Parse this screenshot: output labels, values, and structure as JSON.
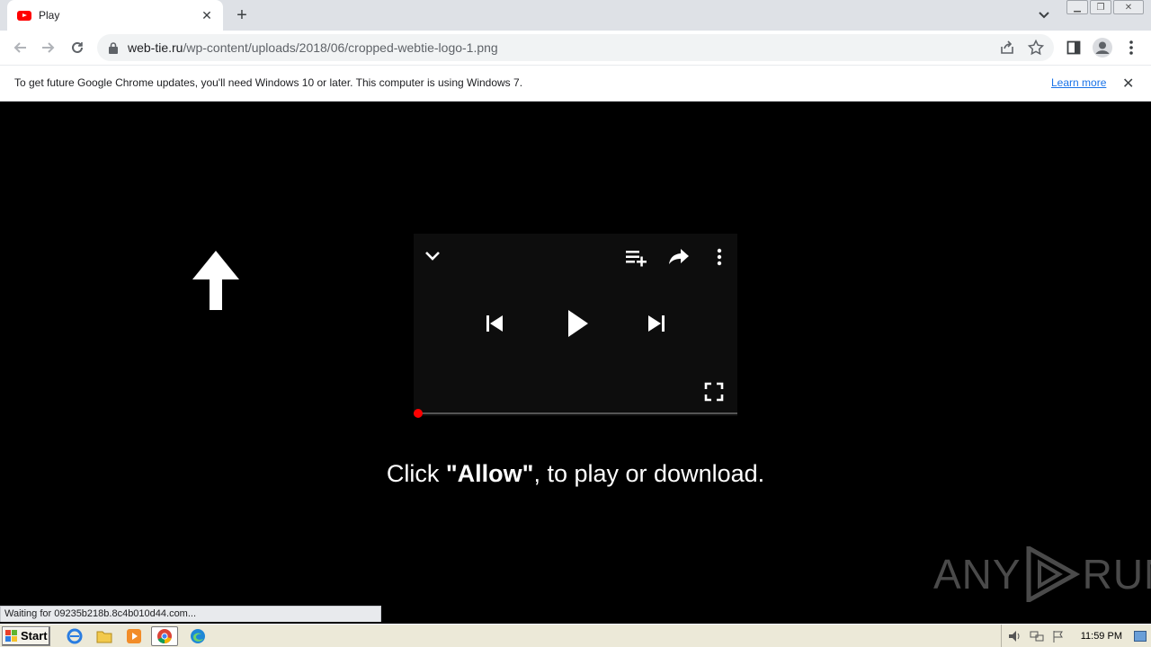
{
  "browser": {
    "tab": {
      "title": "Play",
      "close": "✕"
    },
    "new_tab": "+",
    "address": {
      "host": "web-tie.ru",
      "path": "/wp-content/uploads/2018/06/cropped-webtie-logo-1.png"
    }
  },
  "infobar": {
    "message": "To get future Google Chrome updates, you'll need Windows 10 or later. This computer is using Windows 7.",
    "link": "Learn more",
    "close": "✕"
  },
  "page": {
    "caption_pre": "Click ",
    "caption_bold": "\"Allow\"",
    "caption_post": ", to play or download.",
    "player": {
      "progress_fraction": 0
    }
  },
  "watermark": {
    "left": "ANY",
    "right": "RUN"
  },
  "status": {
    "text": "Waiting for 09235b218b.8c4b010d44.com..."
  },
  "taskbar": {
    "start_label": "Start",
    "clock": "11:59 PM",
    "apps": [
      "internet-explorer-icon",
      "folder-icon",
      "media-player-icon",
      "chrome-icon",
      "edge-icon"
    ]
  },
  "colors": {
    "accent_red": "#ff0000",
    "link_blue": "#1a73e8",
    "page_bg": "#000000"
  }
}
